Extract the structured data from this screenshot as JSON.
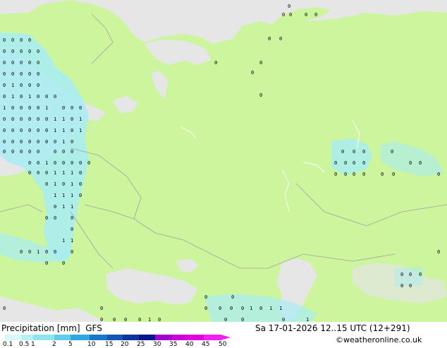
{
  "footer": {
    "title": "Precipitation [mm]",
    "model": "GFS",
    "datetime": "Sa 17-01-2026 12..15 UTC (12+291)",
    "copyright": "©weatheronline.co.uk"
  },
  "legend": {
    "ticks": [
      "0.1",
      "0.5",
      "1",
      "2",
      "5",
      "10",
      "15",
      "20",
      "25",
      "30",
      "35",
      "40",
      "45",
      "50"
    ],
    "colors": [
      "#d8f8f8",
      "#b6f0f4",
      "#8fe4f0",
      "#62ccec",
      "#2ea8e0",
      "#1a78c8",
      "#1456b4",
      "#0e34a0",
      "#0a148c",
      "#a000d0",
      "#c800d8",
      "#e000e0",
      "#f020f0"
    ]
  },
  "map": {
    "land_color": "#ccf59e",
    "sea_color": "#e6e6e6",
    "precip_color": "#a8ecf4",
    "marker_values": [
      "0",
      "1"
    ]
  }
}
